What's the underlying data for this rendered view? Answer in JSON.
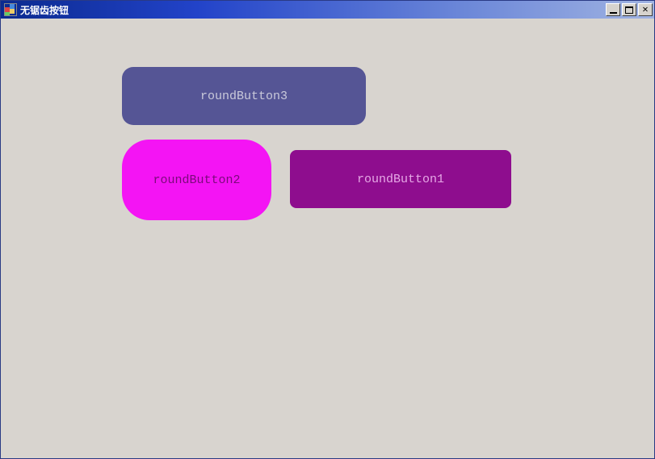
{
  "window": {
    "title": "无锯齿按钮"
  },
  "buttons": {
    "round3": {
      "label": "roundButton3"
    },
    "round2": {
      "label": "roundButton2"
    },
    "round1": {
      "label": "roundButton1"
    }
  }
}
